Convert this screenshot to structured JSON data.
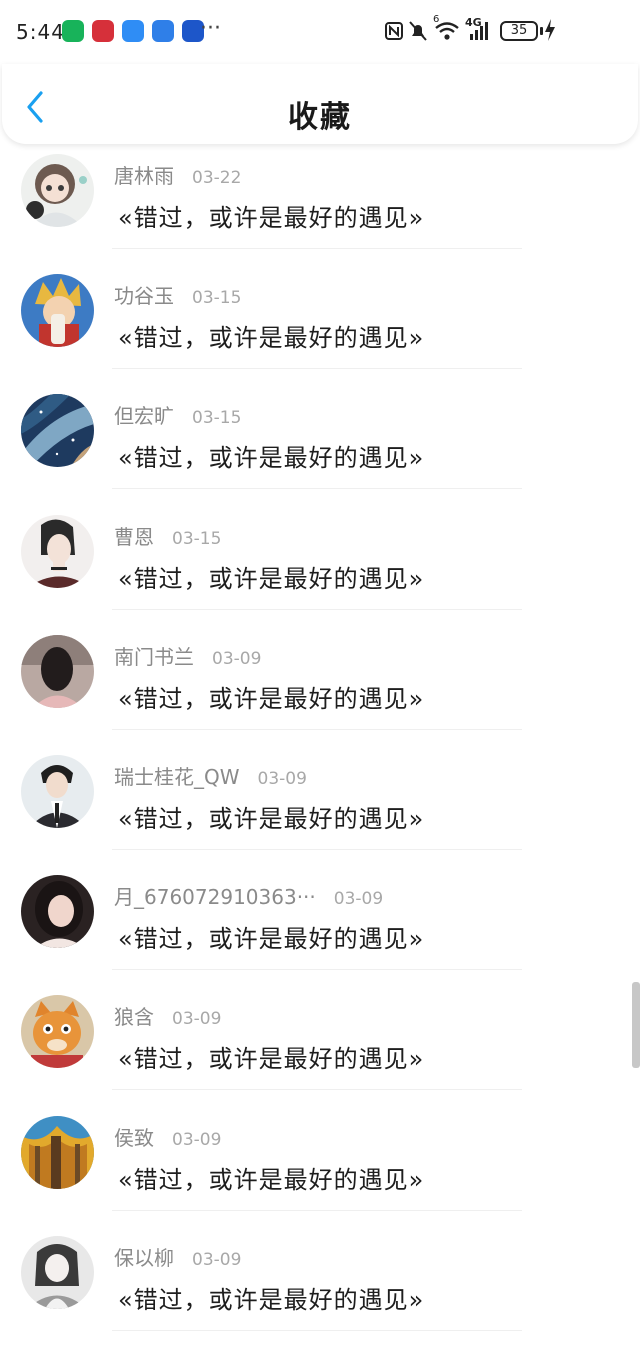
{
  "status_bar": {
    "time": "5:44",
    "battery": "35",
    "network": "4G",
    "wifi_badge": "6",
    "more": "···",
    "app_icons": [
      {
        "icon": "green-app-icon",
        "color": "#18b35a"
      },
      {
        "icon": "huawei-app-icon",
        "color": "#d6303a"
      },
      {
        "icon": "message-app-icon",
        "color": "#2f8df5"
      },
      {
        "icon": "cloud-app-icon",
        "color": "#2f7fe8"
      },
      {
        "icon": "bank-app-icon",
        "color": "#1d56c9"
      }
    ]
  },
  "header": {
    "title": "收藏",
    "back_icon": "chevron-left-icon",
    "accent_color": "#1aa0f0"
  },
  "favorites": [
    {
      "name": "唐林雨",
      "date": "03-22",
      "quote": "«错过，或许是最好的遇见»",
      "avatar": "anime-girl-avatar"
    },
    {
      "name": "功谷玉",
      "date": "03-15",
      "quote": "«错过，或许是最好的遇见»",
      "avatar": "anime-boy-avatar"
    },
    {
      "name": "但宏旷",
      "date": "03-15",
      "quote": "«错过，或许是最好的遇见»",
      "avatar": "galaxy-avatar"
    },
    {
      "name": "曹恩",
      "date": "03-15",
      "quote": "«错过，或许是最好的遇见»",
      "avatar": "sketch-woman-avatar"
    },
    {
      "name": "南门书兰",
      "date": "03-09",
      "quote": "«错过，或许是最好的遇见»",
      "avatar": "girl-back-avatar"
    },
    {
      "name": "瑞士桂花_QW",
      "date": "03-09",
      "quote": "«错过，或许是最好的遇见»",
      "avatar": "boy-suit-avatar"
    },
    {
      "name": "月_676072910363···",
      "date": "03-09",
      "quote": "«错过，或许是最好的遇见»",
      "avatar": "girl-photo-avatar"
    },
    {
      "name": "狼含",
      "date": "03-09",
      "quote": "«错过，或许是最好的遇见»",
      "avatar": "cat-avatar"
    },
    {
      "name": "侯致",
      "date": "03-09",
      "quote": "«错过，或许是最好的遇见»",
      "avatar": "forest-avatar"
    },
    {
      "name": "保以柳",
      "date": "03-09",
      "quote": "«错过，或许是最好的遇见»",
      "avatar": "ink-character-avatar"
    }
  ]
}
